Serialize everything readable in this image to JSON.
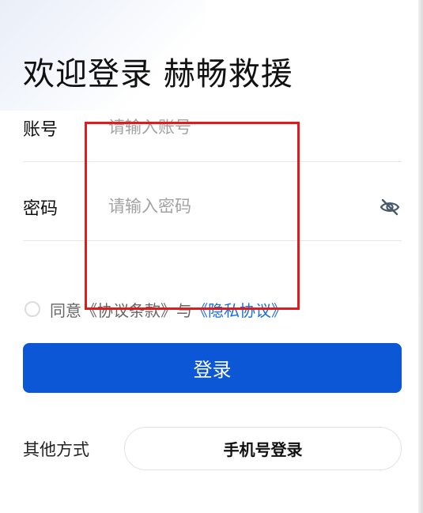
{
  "header": {
    "title": "欢迎登录 赫畅救援"
  },
  "form": {
    "account": {
      "label": "账号",
      "placeholder": "请输入账号",
      "value": ""
    },
    "password": {
      "label": "密码",
      "placeholder": "请输入密码",
      "value": "",
      "toggle_icon": "eye-slash-icon"
    }
  },
  "agreement": {
    "checked": false,
    "prefix": "同意",
    "terms_link": "《协议条款》",
    "connector": "与",
    "privacy_link": "《隐私协议》"
  },
  "actions": {
    "login_label": "登录",
    "other_methods_label": "其他方式",
    "phone_login_label": "手机号登录"
  },
  "colors": {
    "primary": "#0b57d6",
    "link": "#1a6fe0",
    "highlight_box": "#e01b1b",
    "divider": "#e6e6e6"
  }
}
